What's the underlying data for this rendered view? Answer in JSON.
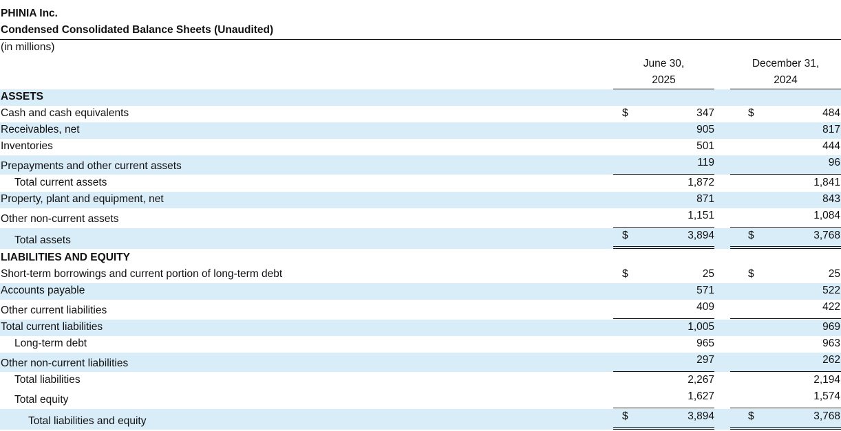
{
  "company": "PHINIA Inc.",
  "title": "Condensed Consolidated Balance Sheets (Unaudited)",
  "units": "(in millions)",
  "columns": [
    {
      "line1": "June 30,",
      "line2": "2025"
    },
    {
      "line1": "December 31,",
      "line2": "2024"
    }
  ],
  "currency_symbol": "$",
  "sections": {
    "assets": "ASSETS",
    "liabilities": "LIABILITIES AND EQUITY"
  },
  "rows": [
    {
      "label": "Cash and cash equivalents",
      "v1": "347",
      "v2": "484"
    },
    {
      "label": "Receivables, net",
      "v1": "905",
      "v2": "817"
    },
    {
      "label": "Inventories",
      "v1": "501",
      "v2": "444"
    },
    {
      "label": "Prepayments and other current assets",
      "v1": "119",
      "v2": "96"
    },
    {
      "label": "Total current assets",
      "v1": "1,872",
      "v2": "1,841"
    },
    {
      "label": "Property, plant and equipment, net",
      "v1": "871",
      "v2": "843"
    },
    {
      "label": "Other non-current assets",
      "v1": "1,151",
      "v2": "1,084"
    },
    {
      "label": "Total assets",
      "v1": "3,894",
      "v2": "3,768"
    },
    {
      "label": "Short-term borrowings and current portion of long-term debt",
      "v1": "25",
      "v2": "25"
    },
    {
      "label": "Accounts payable",
      "v1": "571",
      "v2": "522"
    },
    {
      "label": "Other current liabilities",
      "v1": "409",
      "v2": "422"
    },
    {
      "label": "Total current liabilities",
      "v1": "1,005",
      "v2": "969"
    },
    {
      "label": "Long-term debt",
      "v1": "965",
      "v2": "963"
    },
    {
      "label": "Other non-current liabilities",
      "v1": "297",
      "v2": "262"
    },
    {
      "label": "Total liabilities",
      "v1": "2,267",
      "v2": "2,194"
    },
    {
      "label": "Total equity",
      "v1": "1,627",
      "v2": "1,574"
    },
    {
      "label": "Total liabilities and equity",
      "v1": "3,894",
      "v2": "3,768"
    }
  ]
}
